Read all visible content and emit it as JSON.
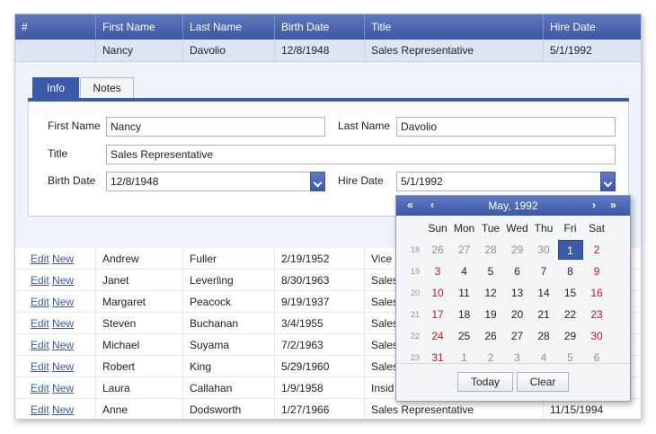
{
  "header": {
    "columns": [
      "#",
      "First Name",
      "Last Name",
      "Birth Date",
      "Title",
      "Hire Date"
    ]
  },
  "master": {
    "first_name": "Nancy",
    "last_name": "Davolio",
    "birth_date": "12/8/1948",
    "title": "Sales Representative",
    "hire_date": "5/1/1992"
  },
  "tabs": {
    "info": "Info",
    "notes": "Notes"
  },
  "form": {
    "first_name_label": "First Name",
    "first_name_value": "Nancy",
    "last_name_label": "Last Name",
    "last_name_value": "Davolio",
    "title_label": "Title",
    "title_value": "Sales Representative",
    "birth_date_label": "Birth Date",
    "birth_date_value": "12/8/1948",
    "hire_date_label": "Hire Date",
    "hire_date_value": "5/1/1992"
  },
  "commands": {
    "edit": "Edit",
    "new": "New"
  },
  "rows": [
    {
      "first": "Andrew",
      "last": "Fuller",
      "birth": "2/19/1952",
      "title": "Vice"
    },
    {
      "first": "Janet",
      "last": "Leverling",
      "birth": "8/30/1963",
      "title": "Sales"
    },
    {
      "first": "Margaret",
      "last": "Peacock",
      "birth": "9/19/1937",
      "title": "Sales"
    },
    {
      "first": "Steven",
      "last": "Buchanan",
      "birth": "3/4/1955",
      "title": "Sales"
    },
    {
      "first": "Michael",
      "last": "Suyama",
      "birth": "7/2/1963",
      "title": "Sales"
    },
    {
      "first": "Robert",
      "last": "King",
      "birth": "5/29/1960",
      "title": "Sales"
    },
    {
      "first": "Laura",
      "last": "Callahan",
      "birth": "1/9/1958",
      "title": "Insid"
    },
    {
      "first": "Anne",
      "last": "Dodsworth",
      "birth": "1/27/1966",
      "title": "Sales Representative",
      "hire": "11/15/1994"
    }
  ],
  "calendar": {
    "nav_prev_year": "«",
    "nav_prev_month": "‹",
    "nav_next_month": "›",
    "nav_next_year": "»",
    "title": "May, 1992",
    "weekdays": [
      "Sun",
      "Mon",
      "Tue",
      "Wed",
      "Thu",
      "Fri",
      "Sat"
    ],
    "weeks": [
      {
        "num": "18",
        "days": [
          {
            "d": "26",
            "o": true
          },
          {
            "d": "27",
            "o": true
          },
          {
            "d": "28",
            "o": true
          },
          {
            "d": "29",
            "o": true
          },
          {
            "d": "30",
            "o": true
          },
          {
            "d": "1",
            "sel": true
          },
          {
            "d": "2"
          }
        ]
      },
      {
        "num": "19",
        "days": [
          {
            "d": "3"
          },
          {
            "d": "4"
          },
          {
            "d": "5"
          },
          {
            "d": "6"
          },
          {
            "d": "7"
          },
          {
            "d": "8"
          },
          {
            "d": "9"
          }
        ]
      },
      {
        "num": "20",
        "days": [
          {
            "d": "10"
          },
          {
            "d": "11"
          },
          {
            "d": "12"
          },
          {
            "d": "13"
          },
          {
            "d": "14"
          },
          {
            "d": "15"
          },
          {
            "d": "16"
          }
        ]
      },
      {
        "num": "21",
        "days": [
          {
            "d": "17"
          },
          {
            "d": "18"
          },
          {
            "d": "19"
          },
          {
            "d": "20"
          },
          {
            "d": "21"
          },
          {
            "d": "22"
          },
          {
            "d": "23"
          }
        ]
      },
      {
        "num": "22",
        "days": [
          {
            "d": "24"
          },
          {
            "d": "25"
          },
          {
            "d": "26"
          },
          {
            "d": "27"
          },
          {
            "d": "28"
          },
          {
            "d": "29"
          },
          {
            "d": "30"
          }
        ]
      },
      {
        "num": "23",
        "days": [
          {
            "d": "31"
          },
          {
            "d": "1",
            "o": true
          },
          {
            "d": "2",
            "o": true
          },
          {
            "d": "3",
            "o": true
          },
          {
            "d": "4",
            "o": true
          },
          {
            "d": "5",
            "o": true
          },
          {
            "d": "6",
            "o": true
          }
        ]
      }
    ],
    "today_label": "Today",
    "clear_label": "Clear"
  }
}
